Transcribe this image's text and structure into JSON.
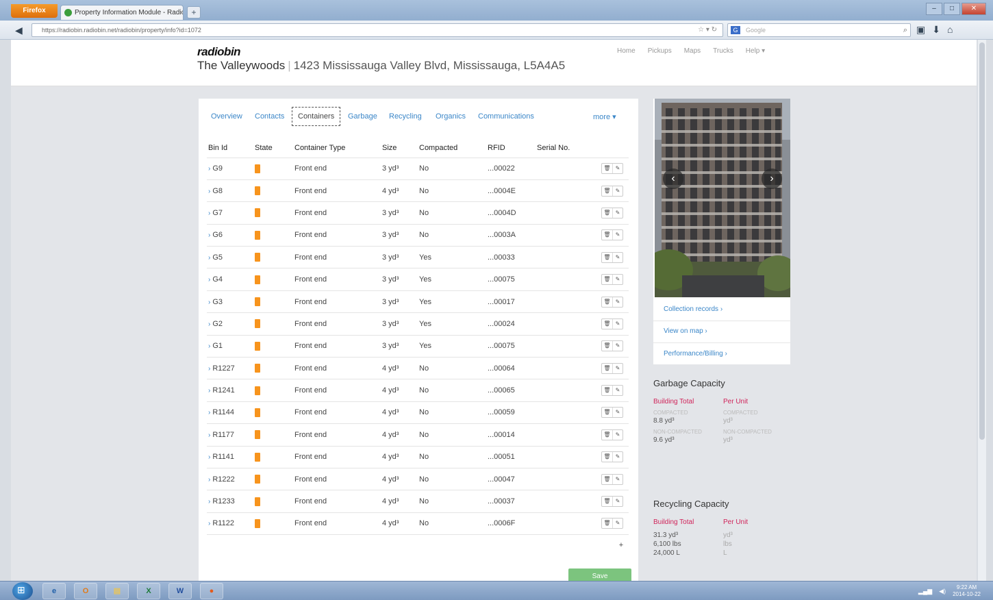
{
  "browser": {
    "app_button": "Firefox",
    "tab_title": "Property Information Module - Radiobin",
    "new_tab": "+",
    "url": "https://radiobin.radiobin.net/radiobin/property/info?id=1072",
    "search_placeholder": "Google"
  },
  "site": {
    "logo": "radiobin",
    "nav": [
      "Home",
      "Pickups",
      "Maps",
      "Trucks",
      "Help ▾"
    ],
    "property_name": "The Valleywoods",
    "property_address": "1423 Mississauga Valley Blvd, Mississauga, L5A4A5"
  },
  "tabs": [
    "Overview",
    "Contacts",
    "Containers",
    "Garbage",
    "Recycling",
    "Organics",
    "Communications",
    "more ▾"
  ],
  "table": {
    "headers": [
      "Bin Id",
      "State",
      "Container Type",
      "Size",
      "Compacted",
      "RFID",
      "Serial No."
    ],
    "rows": [
      {
        "id": "G9",
        "type": "Front end",
        "size": "3 yd³",
        "compacted": "No",
        "rfid": "...00022"
      },
      {
        "id": "G8",
        "type": "Front end",
        "size": "4 yd³",
        "compacted": "No",
        "rfid": "...0004E"
      },
      {
        "id": "G7",
        "type": "Front end",
        "size": "3 yd³",
        "compacted": "No",
        "rfid": "...0004D"
      },
      {
        "id": "G6",
        "type": "Front end",
        "size": "3 yd³",
        "compacted": "No",
        "rfid": "...0003A"
      },
      {
        "id": "G5",
        "type": "Front end",
        "size": "3 yd³",
        "compacted": "Yes",
        "rfid": "...00033"
      },
      {
        "id": "G4",
        "type": "Front end",
        "size": "3 yd³",
        "compacted": "Yes",
        "rfid": "...00075"
      },
      {
        "id": "G3",
        "type": "Front end",
        "size": "3 yd³",
        "compacted": "Yes",
        "rfid": "...00017"
      },
      {
        "id": "G2",
        "type": "Front end",
        "size": "3 yd³",
        "compacted": "Yes",
        "rfid": "...00024"
      },
      {
        "id": "G1",
        "type": "Front end",
        "size": "3 yd³",
        "compacted": "Yes",
        "rfid": "...00075"
      },
      {
        "id": "R1227",
        "type": "Front end",
        "size": "4 yd³",
        "compacted": "No",
        "rfid": "...00064"
      },
      {
        "id": "R1241",
        "type": "Front end",
        "size": "4 yd³",
        "compacted": "No",
        "rfid": "...00065"
      },
      {
        "id": "R1144",
        "type": "Front end",
        "size": "4 yd³",
        "compacted": "No",
        "rfid": "...00059"
      },
      {
        "id": "R1177",
        "type": "Front end",
        "size": "4 yd³",
        "compacted": "No",
        "rfid": "...00014"
      },
      {
        "id": "R1141",
        "type": "Front end",
        "size": "4 yd³",
        "compacted": "No",
        "rfid": "...00051"
      },
      {
        "id": "R1222",
        "type": "Front end",
        "size": "4 yd³",
        "compacted": "No",
        "rfid": "...00047"
      },
      {
        "id": "R1233",
        "type": "Front end",
        "size": "4 yd³",
        "compacted": "No",
        "rfid": "...00037"
      },
      {
        "id": "R1122",
        "type": "Front end",
        "size": "4 yd³",
        "compacted": "No",
        "rfid": "...0006F"
      }
    ],
    "add_label": "+",
    "save_label": "Save"
  },
  "side": {
    "links": [
      "Collection records ›",
      "View on map ›",
      "Performance/Billing ›"
    ],
    "garbage": {
      "title": "Garbage Capacity",
      "col1": "Building Total",
      "col2": "Per Unit",
      "sub1a": "COMPACTED",
      "sub1b": "COMPACTED",
      "val1a": "8.8 yd³",
      "val1b": "yd³",
      "sub2a": "NON-COMPACTED",
      "sub2b": "NON-COMPACTED",
      "val2a": "9.6 yd³",
      "val2b": "yd³"
    },
    "recycling": {
      "title": "Recycling Capacity",
      "col1": "Building Total",
      "col2": "Per Unit",
      "r1a": "31.3 yd³",
      "r1b": "yd³",
      "r2a": "6,100 lbs",
      "r2b": "lbs",
      "r3a": "24,000 L",
      "r3b": "L"
    }
  },
  "taskbar": {
    "time": "9:22 AM",
    "date": "2014-10-22"
  },
  "colors": {
    "link": "#3a86c8",
    "state_orange": "#f7941d",
    "accent_pink": "#d0245a",
    "save_green": "#7cc47e"
  }
}
